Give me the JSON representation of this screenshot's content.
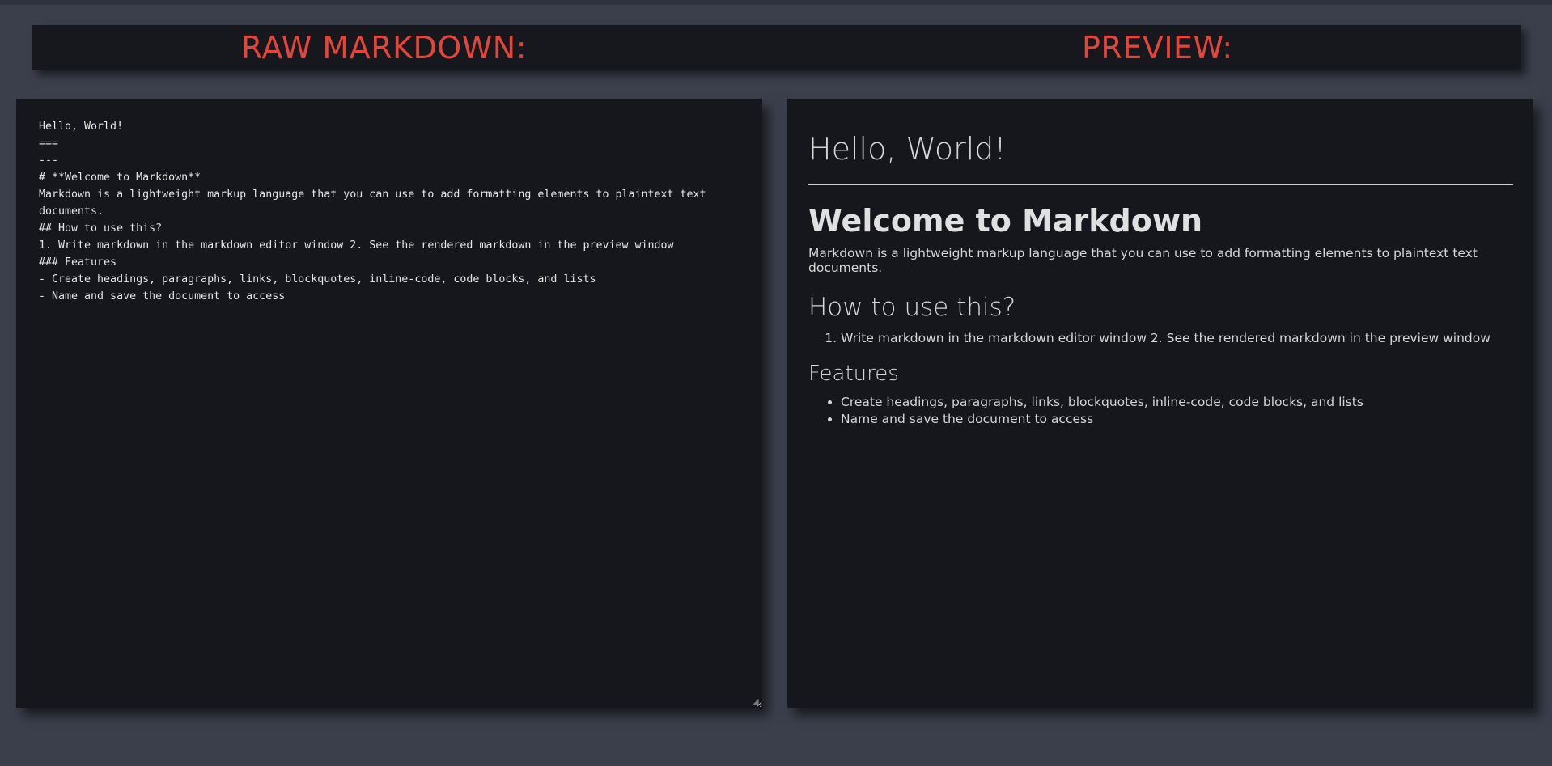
{
  "header": {
    "raw_label": "RAW MARKDOWN:",
    "preview_label": "PREVIEW:"
  },
  "editor": {
    "content": "Hello, World!\n===\n---\n# **Welcome to Markdown**\nMarkdown is a lightweight markup language that you can use to add formatting elements to plaintext text documents.\n## How to use this?\n1. Write markdown in the markdown editor window 2. See the rendered markdown in the preview window\n### Features\n- Create headings, paragraphs, links, blockquotes, inline-code, code blocks, and lists\n- Name and save the document to access"
  },
  "preview": {
    "h1_title": "Hello, World!",
    "h1_welcome": "Welcome to Markdown",
    "intro_paragraph": "Markdown is a lightweight markup language that you can use to add formatting elements to plaintext text documents.",
    "h2_how": "How to use this?",
    "ordered_items": [
      "Write markdown in the markdown editor window 2. See the rendered markdown in the preview window"
    ],
    "h3_features": "Features",
    "bullet_items": [
      "Create headings, paragraphs, links, blockquotes, inline-code, code blocks, and lists",
      "Name and save the document to access"
    ]
  },
  "colors": {
    "background": "#3b3f4c",
    "panel": "#16171c",
    "accent": "#e2463b",
    "text": "#dcdcdc"
  }
}
